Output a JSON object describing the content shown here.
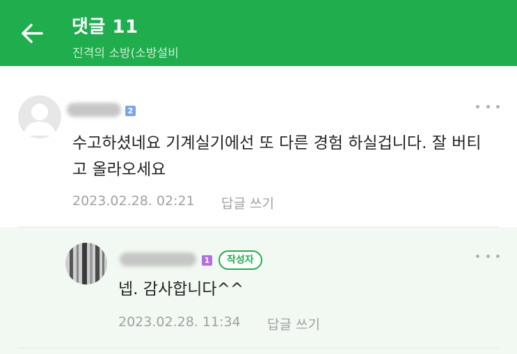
{
  "header": {
    "title": "댓글 11",
    "subtitle": "진격의 소방(소방설비",
    "accent_color": "#1fad4d",
    "back_icon": "arrow-left-icon"
  },
  "comments": [
    {
      "avatar": "default-user-icon",
      "level": "2",
      "text": "수고하셨네요 기계실기에선 또 다른 경험 하실겁니다. 잘 버티고 올라오세요",
      "date": "2023.02.28. 02:21",
      "reply_label": "답글 쓰기",
      "more_icon": "more-dots-icon"
    },
    {
      "avatar": "user-photo",
      "level": "1",
      "author_badge": "작성자",
      "text": "넵. 감사합니다^^",
      "date": "2023.02.28. 11:34",
      "reply_label": "답글 쓰기",
      "more_icon": "more-dots-icon"
    }
  ]
}
